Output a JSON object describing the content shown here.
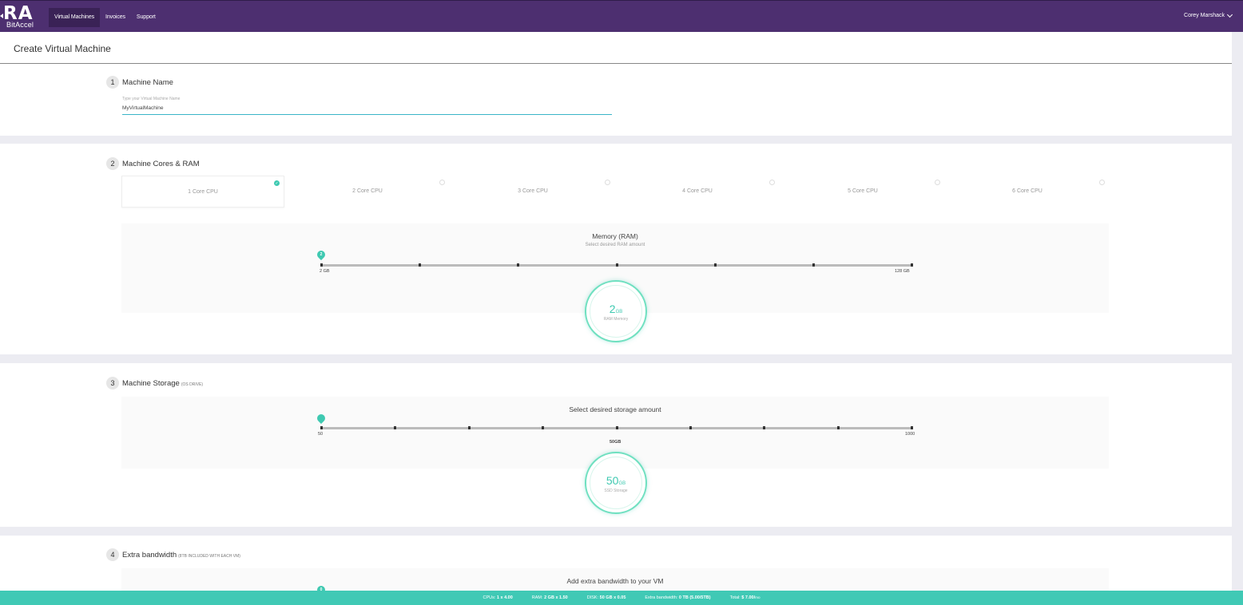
{
  "app": {
    "logo_mark": "RA",
    "logo_sub": "BitAccel"
  },
  "nav": {
    "items": [
      {
        "label": "Virtual Machines",
        "active": true
      },
      {
        "label": "Invoices",
        "active": false
      },
      {
        "label": "Support",
        "active": false
      }
    ]
  },
  "user": {
    "name": "Corey Marshack"
  },
  "page": {
    "title": "Create Virtual Machine"
  },
  "steps": {
    "name": {
      "num": "1",
      "title": "Machine Name",
      "label": "Type your Virtual Machine Name",
      "value": "MyVirtualMachine"
    },
    "cores": {
      "num": "2",
      "title": "Machine Cores & RAM",
      "options": [
        "1 Core CPU",
        "2 Core CPU",
        "3 Core CPU",
        "4 Core CPU",
        "5 Core CPU",
        "6 Core CPU"
      ],
      "selected_index": 0,
      "memory_title": "Memory (RAM)",
      "memory_sub": "Select desired RAM amount",
      "slider_pin": "2",
      "min_label": "2 GB",
      "max_label": "128 GB",
      "value": "2",
      "unit": "GB",
      "value_label": "RAM Memory"
    },
    "storage": {
      "num": "3",
      "title": "Machine Storage",
      "title_note": "(OS DRIVE)",
      "box_title": "Select desired storage amount",
      "min_label": "50",
      "mid_label": "50GB",
      "max_label": "1000",
      "value": "50",
      "unit": "GB",
      "value_label": "SSD Storage"
    },
    "bandwidth": {
      "num": "4",
      "title": "Extra bandwidth",
      "title_note": "(8TB INCLUDED WITH EACH VM)",
      "box_title": "Add extra bandwidth to your VM",
      "slider_pin": "0"
    }
  },
  "footer": {
    "cpus_label": "CPUs:",
    "cpus_value": "1 x 4.00",
    "ram_label": "RAM:",
    "ram_value": "2 GB x 1.50",
    "disk_label": "DISK:",
    "disk_value": "50 GB x 0.05",
    "bw_label": "Extra bandwidth:",
    "bw_value": "0 TB (5.00/5TB)",
    "total_label": "Total:",
    "total_value": "$ 7.00/",
    "total_unit": "mo"
  },
  "colors": {
    "brand": "#4d2f70",
    "accent": "#3fc9b1",
    "footer": "#40c9b5"
  }
}
